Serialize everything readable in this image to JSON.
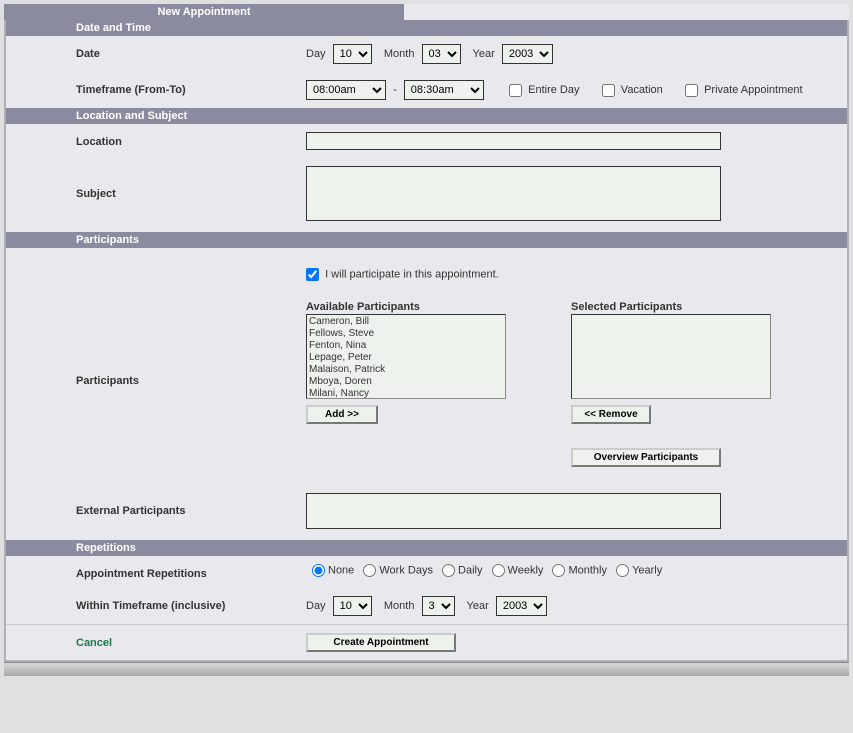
{
  "tab_title": "New Appointment",
  "sections": {
    "date_time": "Date and Time",
    "location_subject": "Location and Subject",
    "participants": "Participants",
    "repetitions": "Repetitions"
  },
  "labels": {
    "date": "Date",
    "timeframe": "Timeframe (From-To)",
    "location": "Location",
    "subject": "Subject",
    "participants": "Participants",
    "external_participants": "External Participants",
    "appointment_repetitions": "Appointment Repetitions",
    "within_timeframe": "Within Timeframe (inclusive)",
    "day": "Day",
    "month": "Month",
    "year": "Year"
  },
  "date": {
    "day": "10",
    "month": "03",
    "year": "2003"
  },
  "time_from": "08:00am",
  "time_to": "08:30am",
  "checkboxes": {
    "entire_day": "Entire Day",
    "vacation": "Vacation",
    "private_appt": "Private Appointment",
    "i_participate": "I will participate in this appointment."
  },
  "location_value": "",
  "subject_value": "",
  "participants_titles": {
    "available": "Available Participants",
    "selected": "Selected Participants"
  },
  "available_participants": [
    "Cameron, Bill",
    "Fellows, Steve",
    "Fenton, Nina",
    "Lepage, Peter",
    "Malaison, Patrick",
    "Mboya, Doren",
    "Milani, Nancy"
  ],
  "buttons": {
    "add": "Add >>",
    "remove": "<< Remove",
    "overview": "Overview Participants",
    "create": "Create Appointment"
  },
  "external_value": "",
  "repetition_options": {
    "none": "None",
    "work_days": "Work Days",
    "daily": "Daily",
    "weekly": "Weekly",
    "monthly": "Monthly",
    "yearly": "Yearly"
  },
  "within": {
    "day": "10",
    "month": "3",
    "year": "2003"
  },
  "cancel": "Cancel"
}
